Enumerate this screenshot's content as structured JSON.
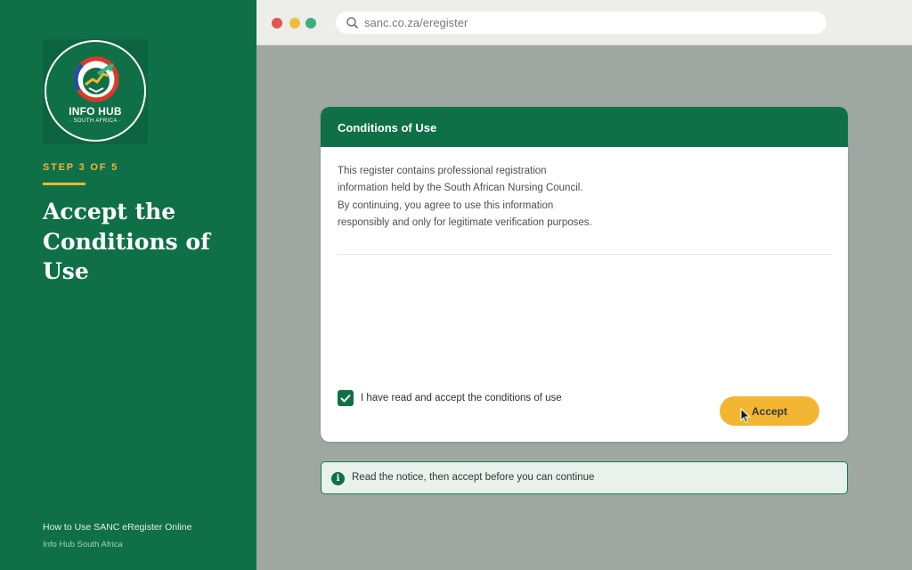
{
  "sidebar": {
    "logo_title": "INFO HUB",
    "logo_subtitle": "· SOUTH AFRICA ·",
    "step": "STEP 3 OF 5",
    "heading": "Accept the Conditions of Use",
    "footer_title": "How to Use SANC eRegister Online",
    "footer_brand": "Info Hub South Africa"
  },
  "browser": {
    "url": "sanc.co.za/eregister"
  },
  "card": {
    "title": "Conditions of Use",
    "body_lines": [
      "This register contains professional registration",
      "information held by the South African Nursing Council.",
      "By continuing, you agree to use this information",
      "responsibly and only for legitimate verification purposes."
    ],
    "checkbox_label": "I have read and accept the conditions of use",
    "checkbox_checked": true,
    "accept_label": "Accept"
  },
  "notice": {
    "icon": "info-icon",
    "text": "Read the notice, then accept before you can continue"
  },
  "colors": {
    "brand_green": "#0f7047",
    "accent_yellow": "#f2b632",
    "page_bg": "#9fa7a2"
  }
}
